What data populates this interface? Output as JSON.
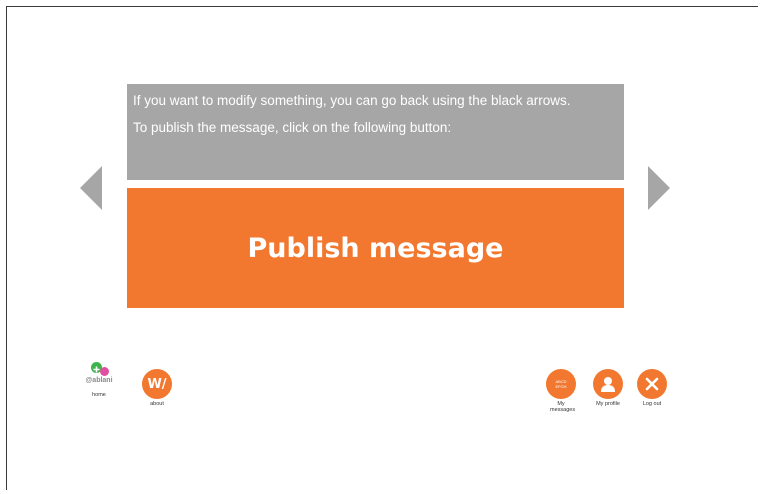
{
  "info": {
    "line1": "If you want to modify something, you can go back using the black arrows.",
    "line2": "To publish the message, click on the following button:"
  },
  "publish_button": {
    "label": "Publish message"
  },
  "nav": {
    "home_brand": "@ablani",
    "home": "home",
    "about_logo": "W/",
    "about": "about",
    "my_messages_icon_text": "ABCD EFGH",
    "my_messages": "My messages",
    "my_profile": "My profile",
    "log_out": "Log out"
  },
  "icons": {
    "left": "chevron-left-icon",
    "right": "chevron-right-icon",
    "profile": "user-icon",
    "logout": "close-icon"
  },
  "colors": {
    "accent": "#f2782f",
    "info_bg": "#a6a6a6",
    "arrow": "#a6a6a6",
    "home_green": "#3cb44b",
    "home_pink": "#e04fa0"
  }
}
